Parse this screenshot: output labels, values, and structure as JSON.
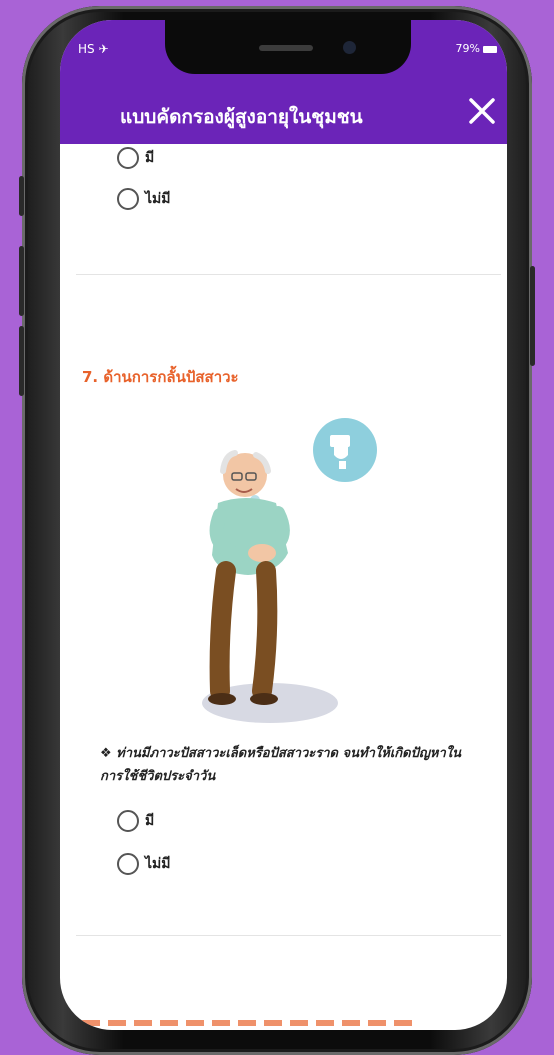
{
  "status": {
    "left": "HS ✈",
    "right": "79%"
  },
  "header": {
    "title": "แบบคัดกรองผู้สูงอายุในชุมชน",
    "close_icon": "close-icon"
  },
  "previous_question": {
    "options": [
      {
        "label": "มี"
      },
      {
        "label": "ไม่มี"
      }
    ]
  },
  "section": {
    "title": "7. ด้านการกลั้นปัสสาวะ",
    "illustration": "elderly-man-toilet-illustration",
    "question": "❖ ท่านมีภาวะปัสสาวะเล็ดหรือปัสสาวะราด จนทำให้เกิดปัญหาในการใช้ชีวิตประจำวัน",
    "options": [
      {
        "label": "มี"
      },
      {
        "label": "ไม่มี"
      }
    ]
  },
  "colors": {
    "background": "#a963d6",
    "header": "#6b24b8",
    "section_title": "#e8622b"
  }
}
